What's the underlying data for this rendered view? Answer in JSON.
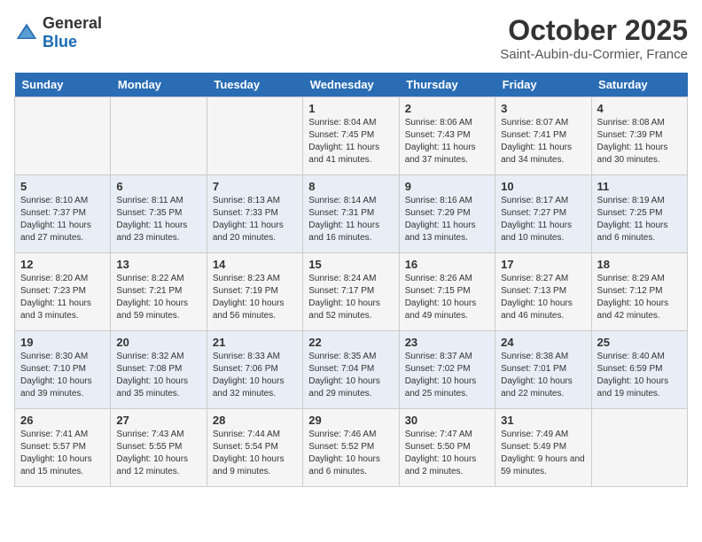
{
  "header": {
    "logo": {
      "general": "General",
      "blue": "Blue"
    },
    "title": "October 2025",
    "subtitle": "Saint-Aubin-du-Cormier, France"
  },
  "weekdays": [
    "Sunday",
    "Monday",
    "Tuesday",
    "Wednesday",
    "Thursday",
    "Friday",
    "Saturday"
  ],
  "weeks": [
    [
      {
        "day": "",
        "sunrise": "",
        "sunset": "",
        "daylight": ""
      },
      {
        "day": "",
        "sunrise": "",
        "sunset": "",
        "daylight": ""
      },
      {
        "day": "",
        "sunrise": "",
        "sunset": "",
        "daylight": ""
      },
      {
        "day": "1",
        "sunrise": "Sunrise: 8:04 AM",
        "sunset": "Sunset: 7:45 PM",
        "daylight": "Daylight: 11 hours and 41 minutes."
      },
      {
        "day": "2",
        "sunrise": "Sunrise: 8:06 AM",
        "sunset": "Sunset: 7:43 PM",
        "daylight": "Daylight: 11 hours and 37 minutes."
      },
      {
        "day": "3",
        "sunrise": "Sunrise: 8:07 AM",
        "sunset": "Sunset: 7:41 PM",
        "daylight": "Daylight: 11 hours and 34 minutes."
      },
      {
        "day": "4",
        "sunrise": "Sunrise: 8:08 AM",
        "sunset": "Sunset: 7:39 PM",
        "daylight": "Daylight: 11 hours and 30 minutes."
      }
    ],
    [
      {
        "day": "5",
        "sunrise": "Sunrise: 8:10 AM",
        "sunset": "Sunset: 7:37 PM",
        "daylight": "Daylight: 11 hours and 27 minutes."
      },
      {
        "day": "6",
        "sunrise": "Sunrise: 8:11 AM",
        "sunset": "Sunset: 7:35 PM",
        "daylight": "Daylight: 11 hours and 23 minutes."
      },
      {
        "day": "7",
        "sunrise": "Sunrise: 8:13 AM",
        "sunset": "Sunset: 7:33 PM",
        "daylight": "Daylight: 11 hours and 20 minutes."
      },
      {
        "day": "8",
        "sunrise": "Sunrise: 8:14 AM",
        "sunset": "Sunset: 7:31 PM",
        "daylight": "Daylight: 11 hours and 16 minutes."
      },
      {
        "day": "9",
        "sunrise": "Sunrise: 8:16 AM",
        "sunset": "Sunset: 7:29 PM",
        "daylight": "Daylight: 11 hours and 13 minutes."
      },
      {
        "day": "10",
        "sunrise": "Sunrise: 8:17 AM",
        "sunset": "Sunset: 7:27 PM",
        "daylight": "Daylight: 11 hours and 10 minutes."
      },
      {
        "day": "11",
        "sunrise": "Sunrise: 8:19 AM",
        "sunset": "Sunset: 7:25 PM",
        "daylight": "Daylight: 11 hours and 6 minutes."
      }
    ],
    [
      {
        "day": "12",
        "sunrise": "Sunrise: 8:20 AM",
        "sunset": "Sunset: 7:23 PM",
        "daylight": "Daylight: 11 hours and 3 minutes."
      },
      {
        "day": "13",
        "sunrise": "Sunrise: 8:22 AM",
        "sunset": "Sunset: 7:21 PM",
        "daylight": "Daylight: 10 hours and 59 minutes."
      },
      {
        "day": "14",
        "sunrise": "Sunrise: 8:23 AM",
        "sunset": "Sunset: 7:19 PM",
        "daylight": "Daylight: 10 hours and 56 minutes."
      },
      {
        "day": "15",
        "sunrise": "Sunrise: 8:24 AM",
        "sunset": "Sunset: 7:17 PM",
        "daylight": "Daylight: 10 hours and 52 minutes."
      },
      {
        "day": "16",
        "sunrise": "Sunrise: 8:26 AM",
        "sunset": "Sunset: 7:15 PM",
        "daylight": "Daylight: 10 hours and 49 minutes."
      },
      {
        "day": "17",
        "sunrise": "Sunrise: 8:27 AM",
        "sunset": "Sunset: 7:13 PM",
        "daylight": "Daylight: 10 hours and 46 minutes."
      },
      {
        "day": "18",
        "sunrise": "Sunrise: 8:29 AM",
        "sunset": "Sunset: 7:12 PM",
        "daylight": "Daylight: 10 hours and 42 minutes."
      }
    ],
    [
      {
        "day": "19",
        "sunrise": "Sunrise: 8:30 AM",
        "sunset": "Sunset: 7:10 PM",
        "daylight": "Daylight: 10 hours and 39 minutes."
      },
      {
        "day": "20",
        "sunrise": "Sunrise: 8:32 AM",
        "sunset": "Sunset: 7:08 PM",
        "daylight": "Daylight: 10 hours and 35 minutes."
      },
      {
        "day": "21",
        "sunrise": "Sunrise: 8:33 AM",
        "sunset": "Sunset: 7:06 PM",
        "daylight": "Daylight: 10 hours and 32 minutes."
      },
      {
        "day": "22",
        "sunrise": "Sunrise: 8:35 AM",
        "sunset": "Sunset: 7:04 PM",
        "daylight": "Daylight: 10 hours and 29 minutes."
      },
      {
        "day": "23",
        "sunrise": "Sunrise: 8:37 AM",
        "sunset": "Sunset: 7:02 PM",
        "daylight": "Daylight: 10 hours and 25 minutes."
      },
      {
        "day": "24",
        "sunrise": "Sunrise: 8:38 AM",
        "sunset": "Sunset: 7:01 PM",
        "daylight": "Daylight: 10 hours and 22 minutes."
      },
      {
        "day": "25",
        "sunrise": "Sunrise: 8:40 AM",
        "sunset": "Sunset: 6:59 PM",
        "daylight": "Daylight: 10 hours and 19 minutes."
      }
    ],
    [
      {
        "day": "26",
        "sunrise": "Sunrise: 7:41 AM",
        "sunset": "Sunset: 5:57 PM",
        "daylight": "Daylight: 10 hours and 15 minutes."
      },
      {
        "day": "27",
        "sunrise": "Sunrise: 7:43 AM",
        "sunset": "Sunset: 5:55 PM",
        "daylight": "Daylight: 10 hours and 12 minutes."
      },
      {
        "day": "28",
        "sunrise": "Sunrise: 7:44 AM",
        "sunset": "Sunset: 5:54 PM",
        "daylight": "Daylight: 10 hours and 9 minutes."
      },
      {
        "day": "29",
        "sunrise": "Sunrise: 7:46 AM",
        "sunset": "Sunset: 5:52 PM",
        "daylight": "Daylight: 10 hours and 6 minutes."
      },
      {
        "day": "30",
        "sunrise": "Sunrise: 7:47 AM",
        "sunset": "Sunset: 5:50 PM",
        "daylight": "Daylight: 10 hours and 2 minutes."
      },
      {
        "day": "31",
        "sunrise": "Sunrise: 7:49 AM",
        "sunset": "Sunset: 5:49 PM",
        "daylight": "Daylight: 9 hours and 59 minutes."
      },
      {
        "day": "",
        "sunrise": "",
        "sunset": "",
        "daylight": ""
      }
    ]
  ]
}
